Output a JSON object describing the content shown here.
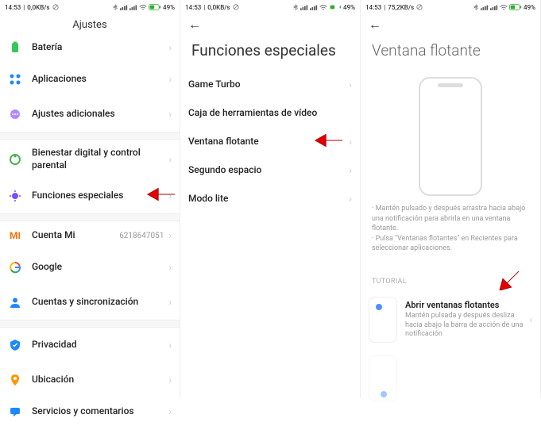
{
  "status": {
    "time": "14:53",
    "net1": "0,0KB/s",
    "net2": "75,2KB/s",
    "battery": "49%"
  },
  "screen1": {
    "title": "Ajustes",
    "items": {
      "bateria": "Batería",
      "aplicaciones": "Aplicaciones",
      "ajustes_adicionales": "Ajustes adicionales",
      "bienestar": "Bienestar digital y control parental",
      "funciones": "Funciones especiales",
      "cuenta_mi": "Cuenta Mi",
      "cuenta_mi_val": "6218647051",
      "google": "Google",
      "cuentas_sync": "Cuentas y sincronización",
      "privacidad": "Privacidad",
      "ubicacion": "Ubicación",
      "servicios": "Servicios y comentarios"
    }
  },
  "screen2": {
    "title": "Funciones especiales",
    "items": {
      "game_turbo": "Game Turbo",
      "caja_video": "Caja de herramientas de vídeo",
      "ventana_flotante": "Ventana flotante",
      "segundo_espacio": "Segundo espacio",
      "modo_lite": "Modo lite"
    }
  },
  "screen3": {
    "title": "Ventana flotante",
    "help1": "· Mantén pulsado y después arrastra hacia abajo una notificación para abrirla en una ventana flotante.",
    "help2": "· Pulsa \"Ventanas flotantes\" en Recientes para seleccionar aplicaciones.",
    "tutorial_label": "TUTORIAL",
    "tutorial1_title": "Abrir ventanas flotantes",
    "tutorial1_sub": "Mantén pulsada y después desliza hacia abajo la barra de acción de una notificación"
  }
}
